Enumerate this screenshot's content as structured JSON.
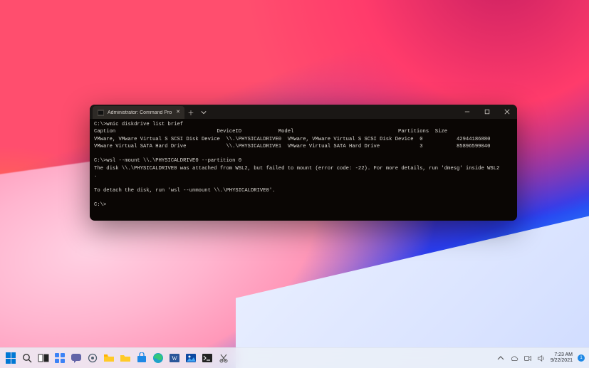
{
  "window": {
    "tab_title": "Administrator: Command Prom",
    "new_tab_tooltip": "New tab",
    "dropdown_tooltip": "Tab options",
    "minimize": "Minimize",
    "maximize": "Maximize",
    "close": "Close"
  },
  "terminal": {
    "lines": [
      "C:\\>wmic diskdrive list brief",
      "Caption                                 DeviceID            Model                                  Partitions  Size",
      "VMware, VMware Virtual S SCSI Disk Device  \\\\.\\PHYSICALDRIVE0  VMware, VMware Virtual S SCSI Disk Device  0           42944186880",
      "VMware Virtual SATA Hard Drive             \\\\.\\PHYSICALDRIVE1  VMware Virtual SATA Hard Drive             3           85896599040",
      "",
      "C:\\>wsl --mount \\\\.\\PHYSICALDRIVE0 --partition 0",
      "The disk \\\\.\\PHYSICALDRIVE0 was attached from WSL2, but failed to mount (error code: -22). For more details, run 'dmesg' inside WSL2",
      ".",
      "",
      "To detach the disk, run 'wsl --unmount \\\\.\\PHYSICALDRIVE0'.",
      "",
      "C:\\>"
    ]
  },
  "taskbar": {
    "items": [
      "start",
      "search",
      "task-view",
      "widgets",
      "chat",
      "settings",
      "file-explorer",
      "folder",
      "store",
      "edge",
      "word",
      "photos",
      "terminal",
      "snipping-tool"
    ]
  },
  "tray": {
    "chevron": "^",
    "onedrive": "cloud",
    "meet_now": "meet",
    "sound": "sound",
    "time": "7:23 AM",
    "date": "9/22/2021",
    "notif_count": "1"
  }
}
